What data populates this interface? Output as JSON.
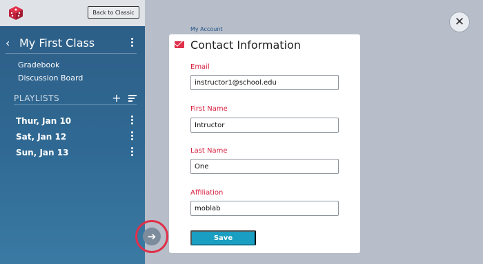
{
  "header": {
    "logo_icon": "dice-logo-icon",
    "back_button_label": "Back to Classic"
  },
  "sidebar": {
    "class_title": "My First Class",
    "links": [
      "Gradebook",
      "Discussion Board"
    ],
    "playlists_label": "PLAYLISTS",
    "playlists": [
      {
        "label": "Thur, Jan 10"
      },
      {
        "label": "Sat, Jan 12"
      },
      {
        "label": "Sun, Jan 13"
      }
    ]
  },
  "breadcrumb": "My Account",
  "modal": {
    "title": "Contact Information",
    "fields": [
      {
        "label": "Email",
        "value": "instructor1@school.edu"
      },
      {
        "label": "First Name",
        "value": "Intructor"
      },
      {
        "label": "Last Name",
        "value": "One"
      },
      {
        "label": "Affiliation",
        "value": "moblab"
      }
    ],
    "save_label": "Save"
  },
  "colors": {
    "accent_red": "#e0304a",
    "button_teal": "#1a9ec1",
    "sidebar_blue": "#2f6993",
    "backdrop": "#b7bec9"
  },
  "icons": {
    "close": "close-icon",
    "back": "chevron-left-icon",
    "more": "kebab-menu-icon",
    "add": "plus-icon",
    "sort": "sort-icon",
    "arrow": "arrow-right-icon",
    "mail": "envelope-icon"
  }
}
